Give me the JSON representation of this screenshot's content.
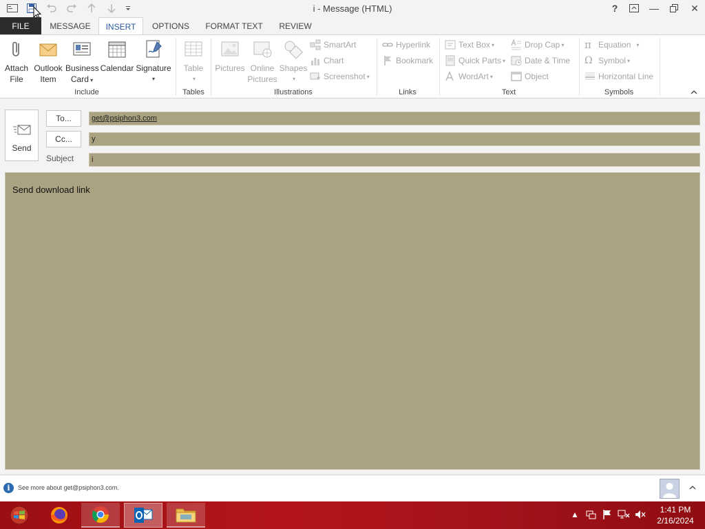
{
  "window": {
    "title": "i - Message (HTML)",
    "help": "?",
    "minimize": "—",
    "close": "✕"
  },
  "tabs": [
    {
      "label": "FILE"
    },
    {
      "label": "MESSAGE"
    },
    {
      "label": "INSERT"
    },
    {
      "label": "OPTIONS"
    },
    {
      "label": "FORMAT TEXT"
    },
    {
      "label": "REVIEW"
    }
  ],
  "ribbon": {
    "include": {
      "label": "Include",
      "attach_file": [
        "Attach",
        "File"
      ],
      "outlook_item": [
        "Outlook",
        "Item"
      ],
      "business_card": [
        "Business",
        "Card"
      ],
      "calendar": "Calendar",
      "signature": "Signature"
    },
    "tables": {
      "label": "Tables",
      "table": "Table"
    },
    "illustrations": {
      "label": "Illustrations",
      "pictures": "Pictures",
      "online_pictures": [
        "Online",
        "Pictures"
      ],
      "shapes": "Shapes",
      "smartart": "SmartArt",
      "chart": "Chart",
      "screenshot": "Screenshot"
    },
    "links": {
      "label": "Links",
      "hyperlink": "Hyperlink",
      "bookmark": "Bookmark"
    },
    "text": {
      "label": "Text",
      "text_box": "Text Box",
      "quick_parts": "Quick Parts",
      "wordart": "WordArt",
      "drop_cap": "Drop Cap",
      "date_time": "Date & Time",
      "object": "Object"
    },
    "symbols": {
      "label": "Symbols",
      "equation": "Equation",
      "symbol": "Symbol",
      "horizontal_line": "Horizontal Line"
    }
  },
  "compose": {
    "send": "Send",
    "to_button": "To...",
    "cc_button": "Cc...",
    "subject_label": "Subject",
    "to_value": "get@psiphon3.com",
    "cc_value": "y",
    "subject_value": "i",
    "body": "Send download link"
  },
  "people_pane": {
    "info_icon_glyph": "i",
    "info_text": "See more about get@psiphon3.com."
  },
  "taskbar": {
    "apps": [
      "start-orb",
      "firefox",
      "chrome",
      "outlook",
      "file-explorer"
    ],
    "time": "1:41 PM",
    "date": "2/16/2024"
  },
  "colors": {
    "field_bg": "#aaa281",
    "accent": "#2b579a",
    "taskbar": "#a3121a"
  }
}
